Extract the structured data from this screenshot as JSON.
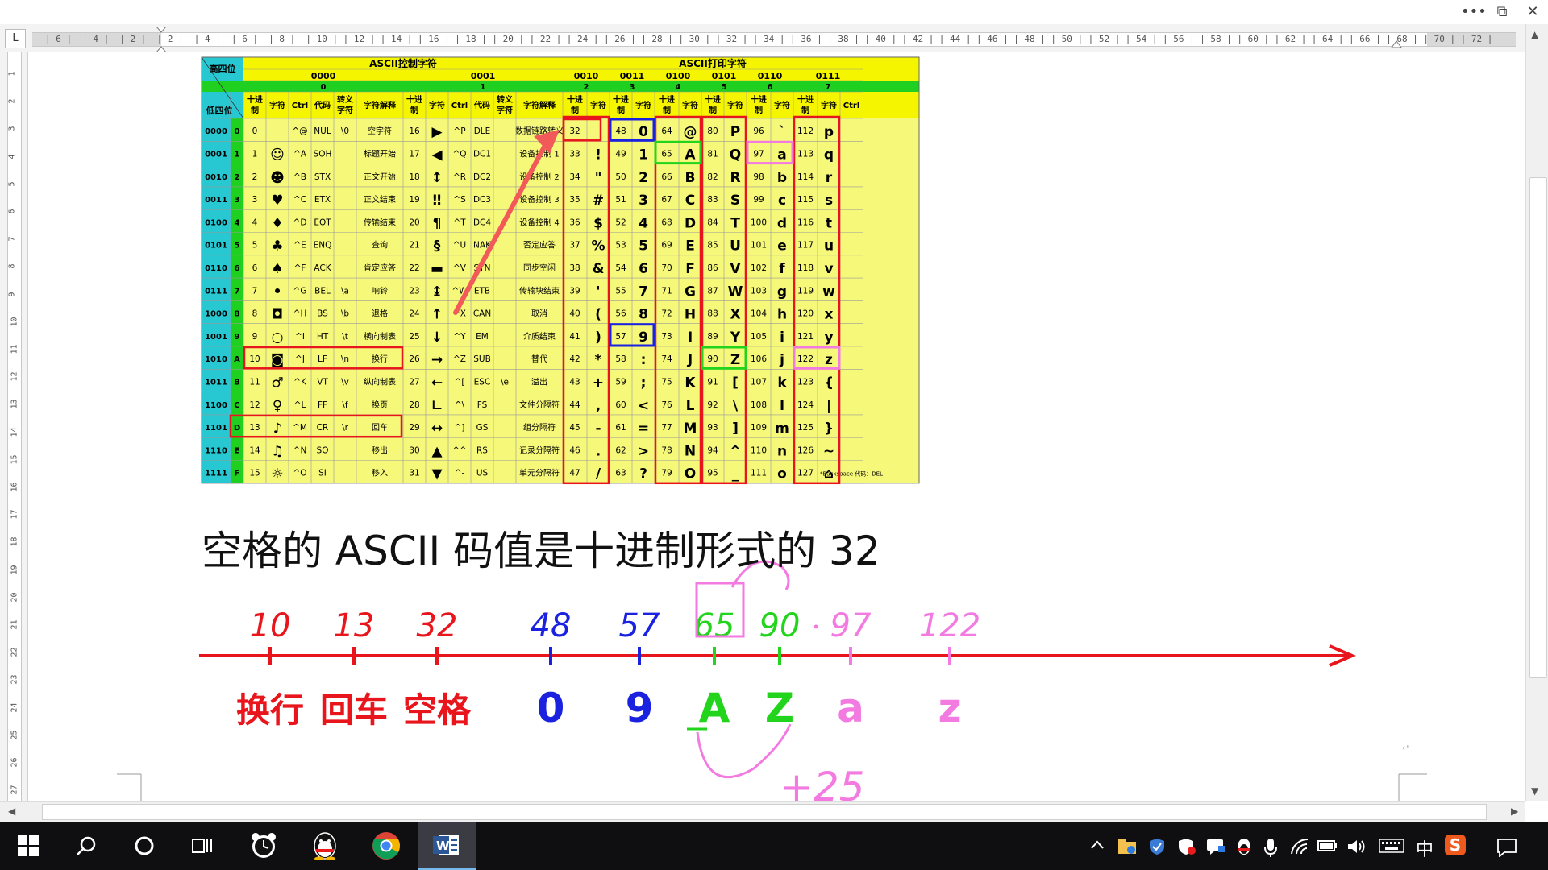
{
  "window": {
    "more_label": "•••",
    "restore_label": "⧉",
    "close_label": "✕"
  },
  "ruler": {
    "corner_label": "L",
    "h_numbers": [
      "6",
      "4",
      "2",
      "2",
      "4",
      "6",
      "8",
      "10",
      "12",
      "14",
      "16",
      "18",
      "20",
      "22",
      "24",
      "26",
      "28",
      "30",
      "32",
      "34",
      "36",
      "38",
      "40",
      "42",
      "44",
      "46",
      "48",
      "50",
      "52",
      "54",
      "56",
      "58",
      "60",
      "62",
      "64",
      "66",
      "68",
      "70",
      "72"
    ],
    "v_numbers": [
      "1",
      "2",
      "3",
      "4",
      "5",
      "6",
      "7",
      "8",
      "9",
      "10",
      "11",
      "12",
      "13",
      "14",
      "15",
      "16",
      "17",
      "18",
      "19",
      "20",
      "21",
      "22",
      "23",
      "24",
      "25",
      "26",
      "27"
    ]
  },
  "ascii_table": {
    "corner_high": "高四位",
    "corner_low": "低四位",
    "section_control": "ASCII控制字符",
    "section_print": "ASCII打印字符",
    "groups": [
      {
        "bin": "0000",
        "dec": "0",
        "cols": [
          "十进制",
          "字符",
          "Ctrl",
          "代码",
          "转义字符",
          "字符解释"
        ]
      },
      {
        "bin": "0001",
        "dec": "1",
        "cols": [
          "十进制",
          "字符",
          "Ctrl",
          "代码",
          "转义字符",
          "字符解释"
        ]
      },
      {
        "bin": "0010",
        "dec": "2",
        "cols": [
          "十进制",
          "字符"
        ]
      },
      {
        "bin": "0011",
        "dec": "3",
        "cols": [
          "十进制",
          "字符"
        ]
      },
      {
        "bin": "0100",
        "dec": "4",
        "cols": [
          "十进制",
          "字符"
        ]
      },
      {
        "bin": "0101",
        "dec": "5",
        "cols": [
          "十进制",
          "字符"
        ]
      },
      {
        "bin": "0110",
        "dec": "6",
        "cols": [
          "十进制",
          "字符"
        ]
      },
      {
        "bin": "0111",
        "dec": "7",
        "cols": [
          "十进制",
          "字符",
          "Ctrl"
        ]
      }
    ],
    "rows": [
      {
        "bin": "0000",
        "hex": "0",
        "c0": [
          "0",
          "",
          "^@",
          "NUL",
          "\\0",
          "空字符"
        ],
        "c1": [
          "16",
          "▶",
          "^P",
          "DLE",
          "",
          "数据链路转义"
        ],
        "p": [
          [
            "32",
            ""
          ],
          [
            "48",
            "0"
          ],
          [
            "64",
            "@"
          ],
          [
            "80",
            "P"
          ],
          [
            "96",
            "`"
          ],
          [
            "112",
            "p"
          ]
        ],
        "tail": ""
      },
      {
        "bin": "0001",
        "hex": "1",
        "c0": [
          "1",
          "☺",
          "^A",
          "SOH",
          "",
          "标题开始"
        ],
        "c1": [
          "17",
          "◀",
          "^Q",
          "DC1",
          "",
          "设备控制 1"
        ],
        "p": [
          [
            "33",
            "!"
          ],
          [
            "49",
            "1"
          ],
          [
            "65",
            "A"
          ],
          [
            "81",
            "Q"
          ],
          [
            "97",
            "a"
          ],
          [
            "113",
            "q"
          ]
        ],
        "tail": ""
      },
      {
        "bin": "0010",
        "hex": "2",
        "c0": [
          "2",
          "☻",
          "^B",
          "STX",
          "",
          "正文开始"
        ],
        "c1": [
          "18",
          "↕",
          "^R",
          "DC2",
          "",
          "设备控制 2"
        ],
        "p": [
          [
            "34",
            "\""
          ],
          [
            "50",
            "2"
          ],
          [
            "66",
            "B"
          ],
          [
            "82",
            "R"
          ],
          [
            "98",
            "b"
          ],
          [
            "114",
            "r"
          ]
        ],
        "tail": ""
      },
      {
        "bin": "0011",
        "hex": "3",
        "c0": [
          "3",
          "♥",
          "^C",
          "ETX",
          "",
          "正文结束"
        ],
        "c1": [
          "19",
          "‼",
          "^S",
          "DC3",
          "",
          "设备控制 3"
        ],
        "p": [
          [
            "35",
            "#"
          ],
          [
            "51",
            "3"
          ],
          [
            "67",
            "C"
          ],
          [
            "83",
            "S"
          ],
          [
            "99",
            "c"
          ],
          [
            "115",
            "s"
          ]
        ],
        "tail": ""
      },
      {
        "bin": "0100",
        "hex": "4",
        "c0": [
          "4",
          "♦",
          "^D",
          "EOT",
          "",
          "传输结束"
        ],
        "c1": [
          "20",
          "¶",
          "^T",
          "DC4",
          "",
          "设备控制 4"
        ],
        "p": [
          [
            "36",
            "$"
          ],
          [
            "52",
            "4"
          ],
          [
            "68",
            "D"
          ],
          [
            "84",
            "T"
          ],
          [
            "100",
            "d"
          ],
          [
            "116",
            "t"
          ]
        ],
        "tail": ""
      },
      {
        "bin": "0101",
        "hex": "5",
        "c0": [
          "5",
          "♣",
          "^E",
          "ENQ",
          "",
          "查询"
        ],
        "c1": [
          "21",
          "§",
          "^U",
          "NAK",
          "",
          "否定应答"
        ],
        "p": [
          [
            "37",
            "%"
          ],
          [
            "53",
            "5"
          ],
          [
            "69",
            "E"
          ],
          [
            "85",
            "U"
          ],
          [
            "101",
            "e"
          ],
          [
            "117",
            "u"
          ]
        ],
        "tail": ""
      },
      {
        "bin": "0110",
        "hex": "6",
        "c0": [
          "6",
          "♠",
          "^F",
          "ACK",
          "",
          "肯定应答"
        ],
        "c1": [
          "22",
          "▬",
          "^V",
          "SYN",
          "",
          "同步空闲"
        ],
        "p": [
          [
            "38",
            "&"
          ],
          [
            "54",
            "6"
          ],
          [
            "70",
            "F"
          ],
          [
            "86",
            "V"
          ],
          [
            "102",
            "f"
          ],
          [
            "118",
            "v"
          ]
        ],
        "tail": ""
      },
      {
        "bin": "0111",
        "hex": "7",
        "c0": [
          "7",
          "•",
          "^G",
          "BEL",
          "\\a",
          "响铃"
        ],
        "c1": [
          "23",
          "↨",
          "^W",
          "ETB",
          "",
          "传输块结束"
        ],
        "p": [
          [
            "39",
            "'"
          ],
          [
            "55",
            "7"
          ],
          [
            "71",
            "G"
          ],
          [
            "87",
            "W"
          ],
          [
            "103",
            "g"
          ],
          [
            "119",
            "w"
          ]
        ],
        "tail": ""
      },
      {
        "bin": "1000",
        "hex": "8",
        "c0": [
          "8",
          "◘",
          "^H",
          "BS",
          "\\b",
          "退格"
        ],
        "c1": [
          "24",
          "↑",
          "^X",
          "CAN",
          "",
          "取消"
        ],
        "p": [
          [
            "40",
            "("
          ],
          [
            "56",
            "8"
          ],
          [
            "72",
            "H"
          ],
          [
            "88",
            "X"
          ],
          [
            "104",
            "h"
          ],
          [
            "120",
            "x"
          ]
        ],
        "tail": ""
      },
      {
        "bin": "1001",
        "hex": "9",
        "c0": [
          "9",
          "○",
          "^I",
          "HT",
          "\\t",
          "横向制表"
        ],
        "c1": [
          "25",
          "↓",
          "^Y",
          "EM",
          "",
          "介质结束"
        ],
        "p": [
          [
            "41",
            ")"
          ],
          [
            "57",
            "9"
          ],
          [
            "73",
            "I"
          ],
          [
            "89",
            "Y"
          ],
          [
            "105",
            "i"
          ],
          [
            "121",
            "y"
          ]
        ],
        "tail": ""
      },
      {
        "bin": "1010",
        "hex": "A",
        "c0": [
          "10",
          "◙",
          "^J",
          "LF",
          "\\n",
          "换行"
        ],
        "c1": [
          "26",
          "→",
          "^Z",
          "SUB",
          "",
          "替代"
        ],
        "p": [
          [
            "42",
            "*"
          ],
          [
            "58",
            ":"
          ],
          [
            "74",
            "J"
          ],
          [
            "90",
            "Z"
          ],
          [
            "106",
            "j"
          ],
          [
            "122",
            "z"
          ]
        ],
        "tail": ""
      },
      {
        "bin": "1011",
        "hex": "B",
        "c0": [
          "11",
          "♂",
          "^K",
          "VT",
          "\\v",
          "纵向制表"
        ],
        "c1": [
          "27",
          "←",
          "^[",
          "ESC",
          "\\e",
          "溢出"
        ],
        "p": [
          [
            "43",
            "+"
          ],
          [
            "59",
            ";"
          ],
          [
            "75",
            "K"
          ],
          [
            "91",
            "["
          ],
          [
            "107",
            "k"
          ],
          [
            "123",
            "{"
          ]
        ],
        "tail": ""
      },
      {
        "bin": "1100",
        "hex": "C",
        "c0": [
          "12",
          "♀",
          "^L",
          "FF",
          "\\f",
          "换页"
        ],
        "c1": [
          "28",
          "∟",
          "^\\",
          "FS",
          "",
          "文件分隔符"
        ],
        "p": [
          [
            "44",
            ","
          ],
          [
            "60",
            "<"
          ],
          [
            "76",
            "L"
          ],
          [
            "92",
            "\\"
          ],
          [
            "108",
            "l"
          ],
          [
            "124",
            "|"
          ]
        ],
        "tail": ""
      },
      {
        "bin": "1101",
        "hex": "D",
        "c0": [
          "13",
          "♪",
          "^M",
          "CR",
          "\\r",
          "回车"
        ],
        "c1": [
          "29",
          "↔",
          "^]",
          "GS",
          "",
          "组分隔符"
        ],
        "p": [
          [
            "45",
            "-"
          ],
          [
            "61",
            "="
          ],
          [
            "77",
            "M"
          ],
          [
            "93",
            "]"
          ],
          [
            "109",
            "m"
          ],
          [
            "125",
            "}"
          ]
        ],
        "tail": ""
      },
      {
        "bin": "1110",
        "hex": "E",
        "c0": [
          "14",
          "♫",
          "^N",
          "SO",
          "",
          "移出"
        ],
        "c1": [
          "30",
          "▲",
          "^^",
          "RS",
          "",
          "记录分隔符"
        ],
        "p": [
          [
            "46",
            "."
          ],
          [
            "62",
            ">"
          ],
          [
            "78",
            "N"
          ],
          [
            "94",
            "^"
          ],
          [
            "110",
            "n"
          ],
          [
            "126",
            "~"
          ]
        ],
        "tail": ""
      },
      {
        "bin": "1111",
        "hex": "F",
        "c0": [
          "15",
          "☼",
          "^O",
          "SI",
          "",
          "移入"
        ],
        "c1": [
          "31",
          "▼",
          "^-",
          "US",
          "",
          "单元分隔符"
        ],
        "p": [
          [
            "47",
            "/"
          ],
          [
            "63",
            "?"
          ],
          [
            "79",
            "O"
          ],
          [
            "95",
            "_"
          ],
          [
            "111",
            "o"
          ],
          [
            "127",
            "⌂"
          ]
        ],
        "tail": "*Backspace 代码：DEL"
      }
    ]
  },
  "heading": "空格的 ASCII 码值是十进制形式的 32",
  "numberline": {
    "ticks": [
      {
        "value": "10",
        "label": "换行",
        "color": "#e8161c"
      },
      {
        "value": "13",
        "label": "回车",
        "color": "#e8161c"
      },
      {
        "value": "32",
        "label": "空格",
        "color": "#e8161c"
      },
      {
        "value": "48",
        "label": "0",
        "color": "#1a22e0"
      },
      {
        "value": "57",
        "label": "9",
        "color": "#1a22e0"
      },
      {
        "value": "65",
        "label": "A",
        "color": "#22d41c"
      },
      {
        "value": "90",
        "label": "Z",
        "color": "#22d41c"
      },
      {
        "value": "97",
        "label": "a",
        "color": "#f27ae0"
      },
      {
        "value": "122",
        "label": "z",
        "color": "#f27ae0"
      }
    ],
    "annotation": "+25"
  },
  "taskbar": {
    "ime_label": "中",
    "sogou_label": "S"
  },
  "colors": {
    "table_yellow": "#f6f87a",
    "table_header_yellow": "#f5f500",
    "table_teal": "#27c8d2",
    "table_green": "#20d020",
    "ink_red": "#e8161c",
    "ink_blue": "#1a22e0",
    "ink_green": "#22d41c",
    "ink_pink": "#f27ae0"
  }
}
